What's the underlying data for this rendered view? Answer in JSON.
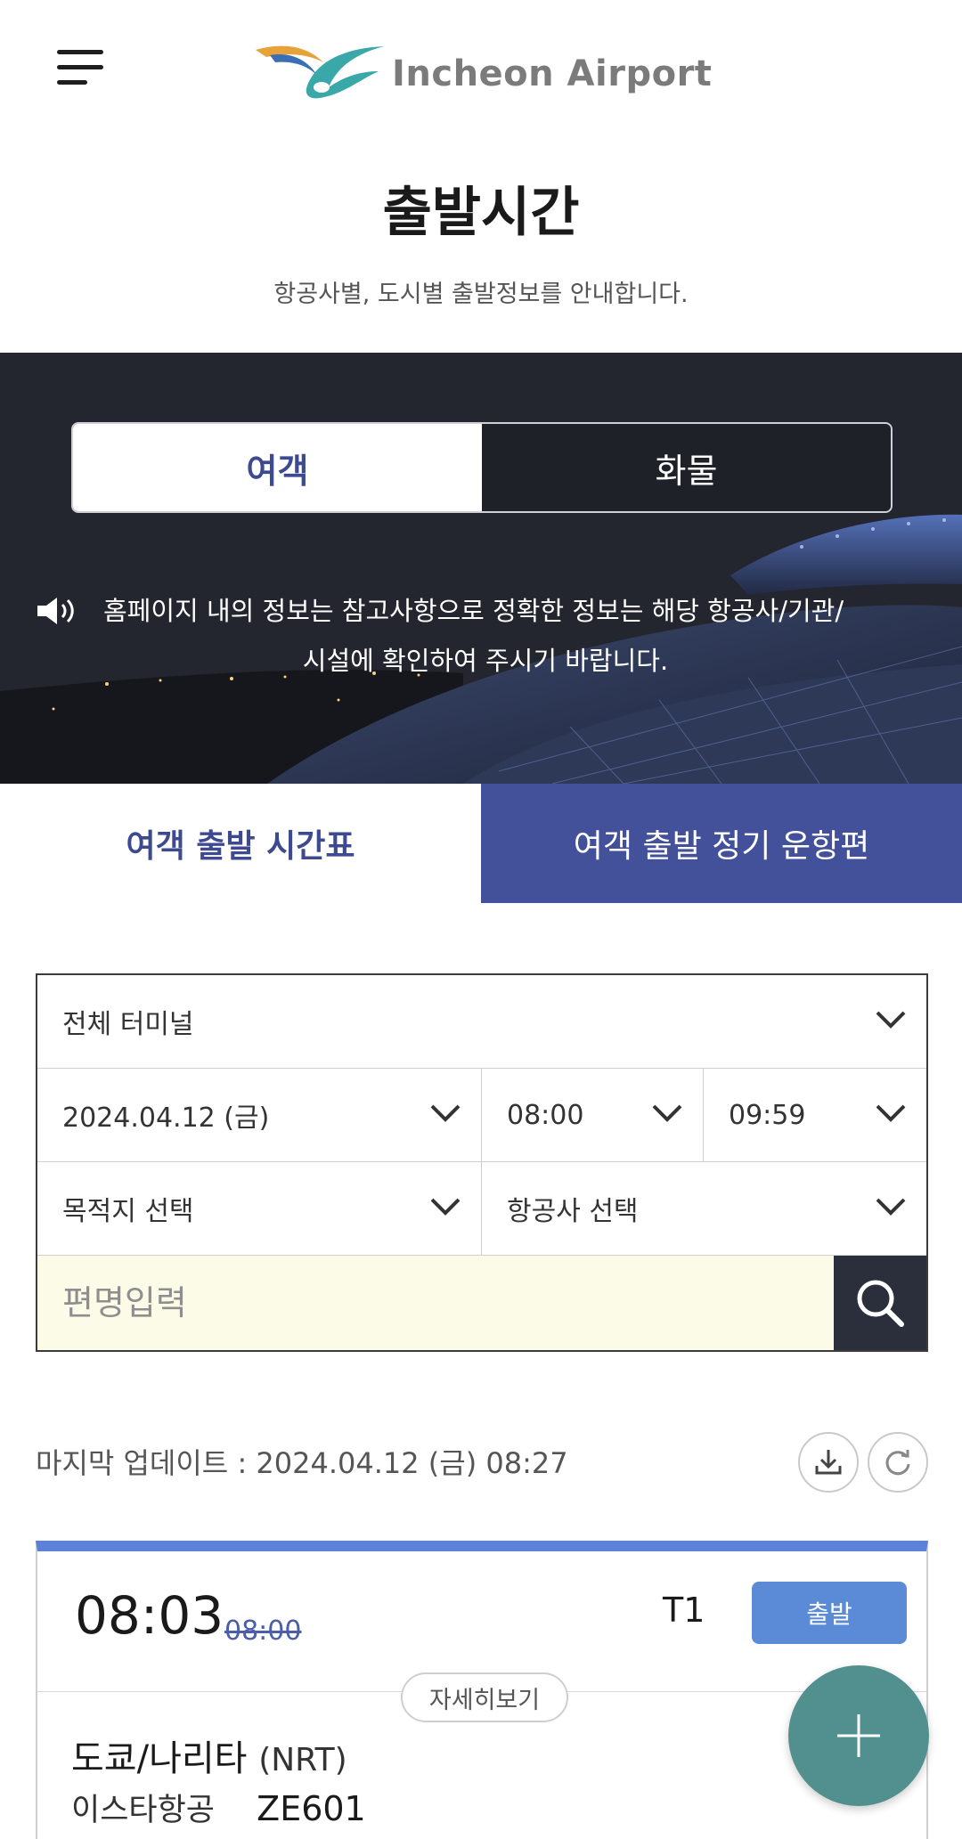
{
  "header": {
    "brand": "Incheon Airport",
    "menu_icon": "hamburger-menu-icon"
  },
  "page": {
    "title": "출발시간",
    "subtitle": "항공사별, 도시별 출발정보를 안내합니다."
  },
  "hero": {
    "toggle": [
      {
        "label": "여객",
        "active": true
      },
      {
        "label": "화물",
        "active": false
      }
    ],
    "notice_icon": "speaker-icon",
    "notice_line1": "홈페이지 내의 정보는 참고사항으로 정확한 정보는 해당 항공사/기관/",
    "notice_line2": "시설에 확인하여 주시기 바랍니다."
  },
  "subtabs": [
    {
      "label": "여객 출발 시간표",
      "active": true
    },
    {
      "label": "여객 출발 정기 운항편",
      "active": false
    }
  ],
  "filters": {
    "terminal": "전체 터미널",
    "date": "2024.04.12 (금)",
    "time_from": "08:00",
    "time_to": "09:59",
    "destination": "목적지 선택",
    "airline": "항공사 선택",
    "flight_placeholder": "편명입력"
  },
  "update": {
    "label": "마지막 업데이트",
    "separator": " : ",
    "value": "2024.04.12 (금) 08:27"
  },
  "flight": {
    "time": "08:03",
    "scheduled": "08:00",
    "terminal": "T1",
    "status": "출발",
    "detail_label": "자세히보기",
    "destination": "도쿄/나리타",
    "dest_code": "(NRT)",
    "airline": "이스타항공",
    "flight_no": "ZE601"
  },
  "colors": {
    "accent": "#3d4a8f",
    "tab_inactive": "#43509a",
    "status": "#5b8ad6",
    "fab": "#52908f",
    "card_top": "#5b82d6"
  }
}
